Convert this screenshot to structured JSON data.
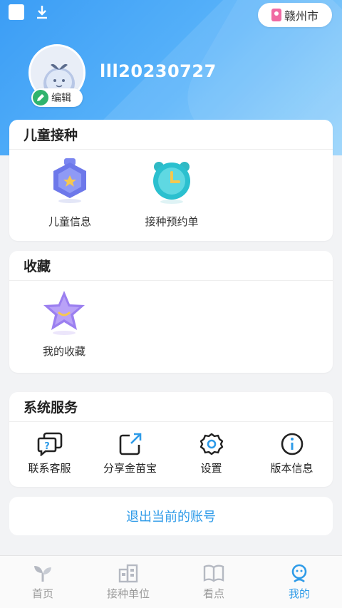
{
  "city": "赣州市",
  "profile": {
    "username": "lll20230727",
    "edit_label": "编辑"
  },
  "child_vaccination": {
    "title": "儿童接种",
    "items": [
      {
        "label": "儿童信息",
        "icon": "child-info-badge-icon"
      },
      {
        "label": "接种预约单",
        "icon": "appointment-clock-icon"
      }
    ]
  },
  "favorites": {
    "title": "收藏",
    "items": [
      {
        "label": "我的收藏",
        "icon": "star-icon"
      }
    ]
  },
  "system_services": {
    "title": "系统服务",
    "items": [
      {
        "label": "联系客服",
        "icon": "customer-service-icon"
      },
      {
        "label": "分享金苗宝",
        "icon": "share-icon"
      },
      {
        "label": "设置",
        "icon": "settings-gear-icon"
      },
      {
        "label": "版本信息",
        "icon": "info-icon"
      }
    ]
  },
  "logout_label": "退出当前的账号",
  "tabbar": {
    "tabs": [
      {
        "label": "首页",
        "icon": "sprout-icon",
        "active": false
      },
      {
        "label": "接种单位",
        "icon": "building-icon",
        "active": false
      },
      {
        "label": "看点",
        "icon": "book-icon",
        "active": false
      },
      {
        "label": "我的",
        "icon": "profile-icon",
        "active": true
      }
    ]
  },
  "colors": {
    "accent": "#2e9be8",
    "header": "#3b9df5",
    "edit_green": "#2fb36d"
  }
}
